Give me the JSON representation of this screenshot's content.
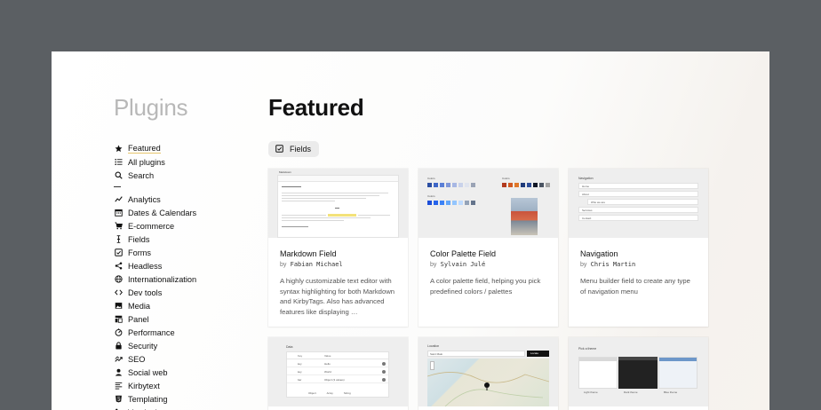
{
  "sidebar": {
    "brand": "Plugins",
    "items_top": [
      {
        "label": "Featured",
        "icon": "star-icon"
      },
      {
        "label": "All plugins",
        "icon": "list-icon"
      },
      {
        "label": "Search",
        "icon": "search-icon"
      }
    ],
    "items_categories": [
      {
        "label": "Analytics",
        "icon": "chart-icon"
      },
      {
        "label": "Dates & Calendars",
        "icon": "calendar-icon"
      },
      {
        "label": "E-commerce",
        "icon": "cart-icon"
      },
      {
        "label": "Fields",
        "icon": "text-cursor-icon"
      },
      {
        "label": "Forms",
        "icon": "checkbox-icon"
      },
      {
        "label": "Headless",
        "icon": "share-icon"
      },
      {
        "label": "Internationalization",
        "icon": "globe-icon"
      },
      {
        "label": "Dev tools",
        "icon": "code-icon"
      },
      {
        "label": "Media",
        "icon": "image-icon"
      },
      {
        "label": "Panel",
        "icon": "layout-icon"
      },
      {
        "label": "Performance",
        "icon": "gauge-icon"
      },
      {
        "label": "Security",
        "icon": "lock-icon"
      },
      {
        "label": "SEO",
        "icon": "trend-icon"
      },
      {
        "label": "Social web",
        "icon": "user-icon"
      },
      {
        "label": "Kirbytext",
        "icon": "text-icon"
      },
      {
        "label": "Templating",
        "icon": "html-icon"
      },
      {
        "label": "Versioning",
        "icon": "branch-icon"
      }
    ]
  },
  "main": {
    "heading": "Featured",
    "filter_chip": "Fields",
    "cards": [
      {
        "title": "Markdown Field",
        "by": "by",
        "author": "Fabian Michael",
        "description": "A highly customizable text editor with syntax highlighting for both Markdown and KirbyTags. Also has advanced features like displaying …",
        "thumb": {
          "label": "Markdown"
        }
      },
      {
        "title": "Color Palette Field",
        "by": "by",
        "author": "Sylvain Julé",
        "description": "A color palette field, helping you pick predefined colors / palettes",
        "thumb": {
          "label_left": "Colors",
          "label_right": "Colors",
          "label_second": "Colors"
        }
      },
      {
        "title": "Navigation",
        "by": "by",
        "author": "Chris Martin",
        "description": "Menu builder field to create any type of navigation menu",
        "thumb": {
          "label": "Navigation",
          "items": [
            "Home",
            "About",
            "Who we are",
            "Services",
            "Contact"
          ]
        }
      },
      {
        "thumb": {
          "label": "Data",
          "headers": [
            "Key",
            "Value"
          ],
          "rows": [
            [
              "key",
              "Hello"
            ],
            [
              "key",
              "World"
            ],
            [
              "bar",
              "Object (3 values)"
            ]
          ],
          "options": [
            "Object",
            "Array",
            "String"
          ]
        }
      },
      {
        "thumb": {
          "label": "Location",
          "search": "Saint Malo",
          "button": "Locate"
        }
      },
      {
        "thumb": {
          "label": "Pick a theme",
          "options": [
            "Light theme",
            "Dark theme",
            "Blue theme"
          ]
        }
      }
    ]
  },
  "colors": {
    "accent_underline": "#e6c66c",
    "backdrop": "#5b5f63",
    "swatches_row1": [
      "#2b4ea2",
      "#3e66c7",
      "#5a7fd6",
      "#7f97d9",
      "#a7b7e3",
      "#c9d2ea",
      "#e0e4ee",
      "#9aa3b5"
    ],
    "swatches_row2": [
      "#b23a1e",
      "#d15a22",
      "#e0782a",
      "#1f3b7a",
      "#2e4e99",
      "#111827",
      "#4b5563",
      "#a3a3a3"
    ],
    "swatches_row3": [
      "#1d4ed8",
      "#2563eb",
      "#3b82f6",
      "#60a5fa",
      "#93c5fd",
      "#bfdbfe",
      "#94a3b8",
      "#64748b"
    ]
  }
}
